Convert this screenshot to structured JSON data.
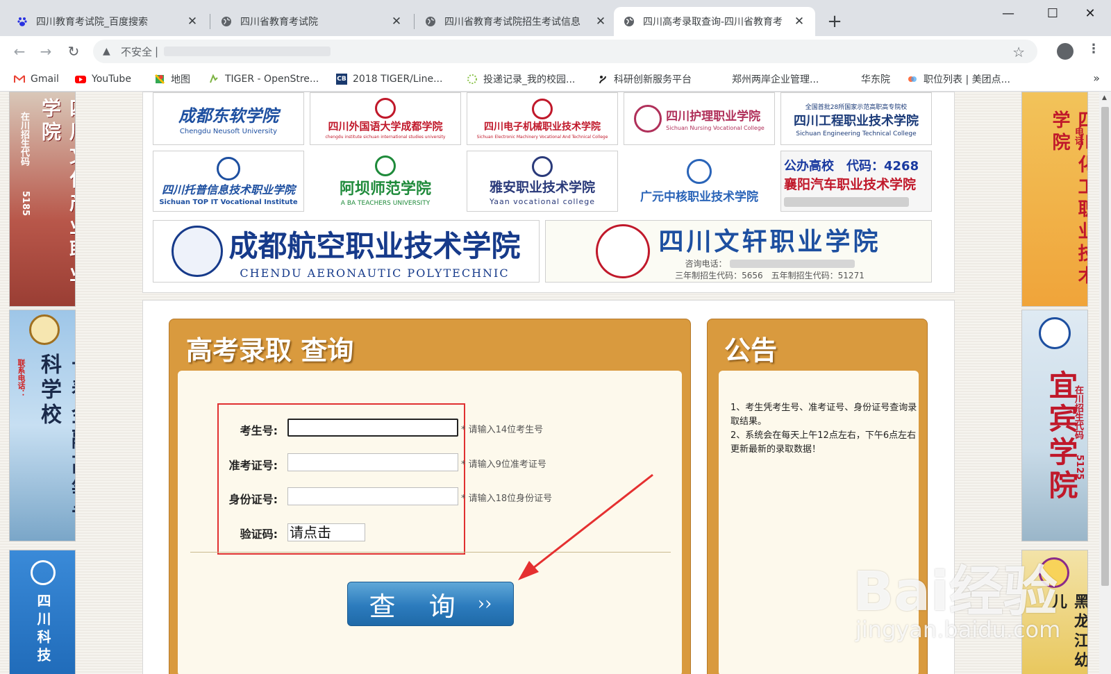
{
  "browser": {
    "tabs": [
      {
        "title": "四川教育考试院_百度搜索",
        "icon": "baidu-icon"
      },
      {
        "title": "四川省教育考试院",
        "icon": "globe-icon"
      },
      {
        "title": "四川省教育考试院招生考试信息",
        "icon": "globe-icon"
      },
      {
        "title": "四川高考录取查询-四川省教育考",
        "icon": "globe-icon"
      }
    ],
    "new_tab": "+",
    "address": {
      "security_label": "不安全",
      "separator": "|"
    },
    "bookmarks": [
      {
        "label": "Gmail",
        "icon": "gmail-icon"
      },
      {
        "label": "YouTube",
        "icon": "youtube-icon"
      },
      {
        "label": "地图",
        "icon": "maps-icon"
      },
      {
        "label": "TIGER - OpenStre...",
        "icon": "page-icon"
      },
      {
        "label": "2018 TIGER/Line...",
        "icon": "cb-icon"
      },
      {
        "label": "投递记录_我的校园...",
        "icon": "page-icon"
      },
      {
        "label": "科研创新服务平台",
        "icon": "page-icon"
      },
      {
        "label": "郑州两岸企业管理...",
        "icon": "none"
      },
      {
        "label": "华东院",
        "icon": "none"
      },
      {
        "label": "职位列表 | 美团点...",
        "icon": "page-icon"
      }
    ],
    "bookmarks_more": "»",
    "colors": {
      "tabbar": "#dee1e6",
      "toolbar": "#ffffff"
    }
  },
  "side_ads": {
    "left_top": {
      "text": "四川文化产业职业学院",
      "code_label": "在川招生代码",
      "code": "5185"
    },
    "left_mid": {
      "text": "长春金融高等专科学校",
      "contact": "联系电话："
    },
    "left_bottom": {
      "text": "四川科技"
    },
    "right_top": {
      "text": "四川化工职业技术学院",
      "contact": "电话"
    },
    "right_mid": {
      "text": "宜宾学院",
      "code_label": "在川招生代码",
      "code": "5125"
    },
    "right_bottom": {
      "text": "黑龙江幼儿"
    }
  },
  "logos": {
    "row1": [
      {
        "cn": "成都东软学院",
        "en": "Chengdu Neusoft University",
        "color": "#1d4fa0"
      },
      {
        "cn": "四川外国语大学成都学院",
        "en": "chengdu institute sichuan international studies university",
        "color": "#c0182a"
      },
      {
        "cn": "四川电子机械职业技术学院",
        "en": "Sichuan Electronic Machinery Vocational And Technical College",
        "color": "#c0182a"
      },
      {
        "cn": "四川护理职业学院",
        "en": "Sichuan Nursing Vocational College",
        "color": "#b0305a"
      },
      {
        "cn": "四川工程职业技术学院",
        "top": "全国首批28所国家示范高职高专院校",
        "en": "Sichuan Engineering Technical College",
        "color": "#1a3a78"
      }
    ],
    "row2": [
      {
        "cn": "四川托普信息技术职业学院",
        "en": "Sichuan TOP IT Vocational Institute",
        "color": "#1d4fa0"
      },
      {
        "cn": "阿坝师范学院",
        "en": "A BA TEACHERS UNIVERSITY",
        "color": "#1e8a3a"
      },
      {
        "cn": "雅安职业技术学院",
        "en": "Yaan vocational college",
        "color": "#2a3a7a"
      },
      {
        "cn": "广元中核职业技术学院",
        "en": "",
        "color": "#2a64b8"
      },
      {
        "line1": "公办高校　代码：4268",
        "line2": "襄阳汽车职业技术学院",
        "color": "#c0182a"
      }
    ],
    "row3": [
      {
        "cn": "成都航空职业技术学院",
        "en": "CHENDU AERONAUTIC POLYTECHNIC",
        "color": "#163a8a"
      },
      {
        "cn": "四川文轩职业学院",
        "consult": "咨询电话：",
        "codes": "三年制招生代码：5656　五年制招生代码：51271",
        "color": "#1d4fa0"
      }
    ]
  },
  "query_box": {
    "title": "高考录取 查询",
    "fields": [
      {
        "label": "考生号:",
        "value": "",
        "hint": "* 请输入14位考生号"
      },
      {
        "label": "准考证号:",
        "value": "",
        "hint": "* 请输入9位准考证号"
      },
      {
        "label": "身份证号:",
        "value": "",
        "hint": "* 请输入18位身份证号"
      }
    ],
    "captcha_label": "验证码:",
    "captcha_value": "请点击",
    "submit_label": "查 询",
    "submit_arrow": "››",
    "accent": "#d99a3e"
  },
  "notice_box": {
    "title": "公告",
    "lines": [
      "1、考生凭考生号、准考证号、身份证号查询录取结果。",
      "2、系统会在每天上午12点左右，下午6点左右更新最新的录取数据！"
    ]
  },
  "watermark": {
    "text": "Bai经验",
    "sub": "jingyan.baidu.com"
  }
}
